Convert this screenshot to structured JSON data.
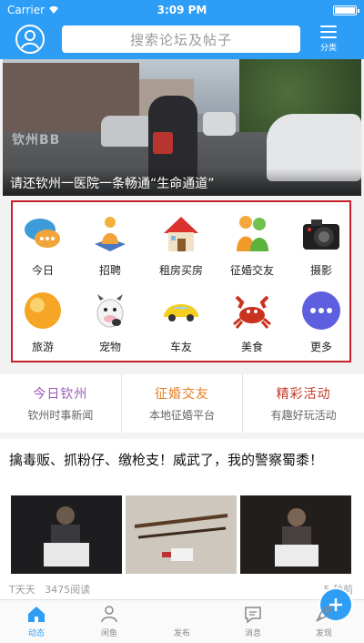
{
  "status": {
    "carrier": "Carrier",
    "time": "3:09 PM"
  },
  "header": {
    "search_placeholder": "搜索论坛及帖子",
    "menu_label": "分类"
  },
  "banner": {
    "watermark": "钦州BB",
    "caption": "请还钦州一医院一条畅通“生命通道”"
  },
  "categories": [
    {
      "label": "今日",
      "icon": "chat-bubbles-icon"
    },
    {
      "label": "招聘",
      "icon": "person-book-icon"
    },
    {
      "label": "租房买房",
      "icon": "house-icon"
    },
    {
      "label": "征婚交友",
      "icon": "couple-icon"
    },
    {
      "label": "摄影",
      "icon": "camera-icon"
    },
    {
      "label": "旅游",
      "icon": "sun-icon"
    },
    {
      "label": "宠物",
      "icon": "cow-icon"
    },
    {
      "label": "车友",
      "icon": "car-icon"
    },
    {
      "label": "美食",
      "icon": "crab-icon"
    },
    {
      "label": "更多",
      "icon": "more-icon"
    }
  ],
  "features": [
    {
      "title": "今日钦州",
      "subtitle": "钦州时事新闻",
      "color": "#9b59b6"
    },
    {
      "title": "征婚交友",
      "subtitle": "本地征婚平台",
      "color": "#e67e22"
    },
    {
      "title": "精彩活动",
      "subtitle": "有趣好玩活动",
      "color": "#c0392b"
    }
  ],
  "post": {
    "title": "擒毒贩、抓粉仔、缴枪支！威武了，我的警察蜀黍！",
    "author": "T天天",
    "views": "3475阅读",
    "time": "5 秒前"
  },
  "tabs": [
    {
      "label": "动态",
      "icon": "home-icon"
    },
    {
      "label": "闲鱼",
      "icon": "people-icon"
    },
    {
      "label": "发布",
      "icon": "plus-icon"
    },
    {
      "label": "消息",
      "icon": "message-icon"
    },
    {
      "label": "发现",
      "icon": "rocket-icon"
    }
  ],
  "colors": {
    "brand": "#2d9df5",
    "grid_border": "#c8202a"
  }
}
